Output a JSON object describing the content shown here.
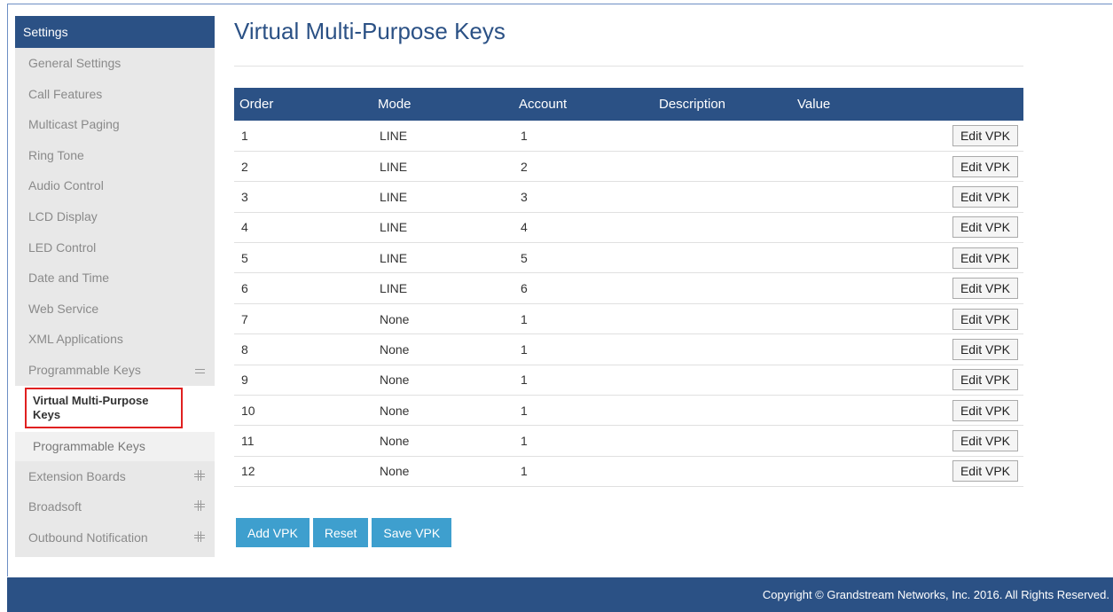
{
  "sidebar": {
    "header": "Settings",
    "items": [
      {
        "label": "General Settings"
      },
      {
        "label": "Call Features"
      },
      {
        "label": "Multicast Paging"
      },
      {
        "label": "Ring Tone"
      },
      {
        "label": "Audio Control"
      },
      {
        "label": "LCD Display"
      },
      {
        "label": "LED Control"
      },
      {
        "label": "Date and Time"
      },
      {
        "label": "Web Service"
      },
      {
        "label": "XML Applications"
      },
      {
        "label": "Programmable Keys"
      }
    ],
    "sub_items": [
      {
        "label": "Virtual Multi-Purpose Keys"
      },
      {
        "label": "Programmable Keys"
      }
    ],
    "after_items": [
      {
        "label": "Extension Boards"
      },
      {
        "label": "Broadsoft"
      },
      {
        "label": "Outbound Notification"
      }
    ]
  },
  "main": {
    "title": "Virtual Multi-Purpose Keys",
    "table": {
      "headers": [
        "Order",
        "Mode",
        "Account",
        "Description",
        "Value"
      ],
      "rows": [
        {
          "order": "1",
          "mode": "LINE",
          "account": "1",
          "description": "",
          "value": ""
        },
        {
          "order": "2",
          "mode": "LINE",
          "account": "2",
          "description": "",
          "value": ""
        },
        {
          "order": "3",
          "mode": "LINE",
          "account": "3",
          "description": "",
          "value": ""
        },
        {
          "order": "4",
          "mode": "LINE",
          "account": "4",
          "description": "",
          "value": ""
        },
        {
          "order": "5",
          "mode": "LINE",
          "account": "5",
          "description": "",
          "value": ""
        },
        {
          "order": "6",
          "mode": "LINE",
          "account": "6",
          "description": "",
          "value": ""
        },
        {
          "order": "7",
          "mode": "None",
          "account": "1",
          "description": "",
          "value": ""
        },
        {
          "order": "8",
          "mode": "None",
          "account": "1",
          "description": "",
          "value": ""
        },
        {
          "order": "9",
          "mode": "None",
          "account": "1",
          "description": "",
          "value": ""
        },
        {
          "order": "10",
          "mode": "None",
          "account": "1",
          "description": "",
          "value": ""
        },
        {
          "order": "11",
          "mode": "None",
          "account": "1",
          "description": "",
          "value": ""
        },
        {
          "order": "12",
          "mode": "None",
          "account": "1",
          "description": "",
          "value": ""
        }
      ],
      "edit_label": "Edit VPK"
    },
    "buttons": {
      "add": "Add VPK",
      "reset": "Reset",
      "save": "Save VPK"
    }
  },
  "footer": {
    "copyright": "Copyright © Grandstream Networks, Inc. 2016. All Rights Reserved."
  },
  "colors": {
    "header_blue": "#2b5185",
    "button_blue": "#3e9fce",
    "highlight_red": "#e02020"
  }
}
